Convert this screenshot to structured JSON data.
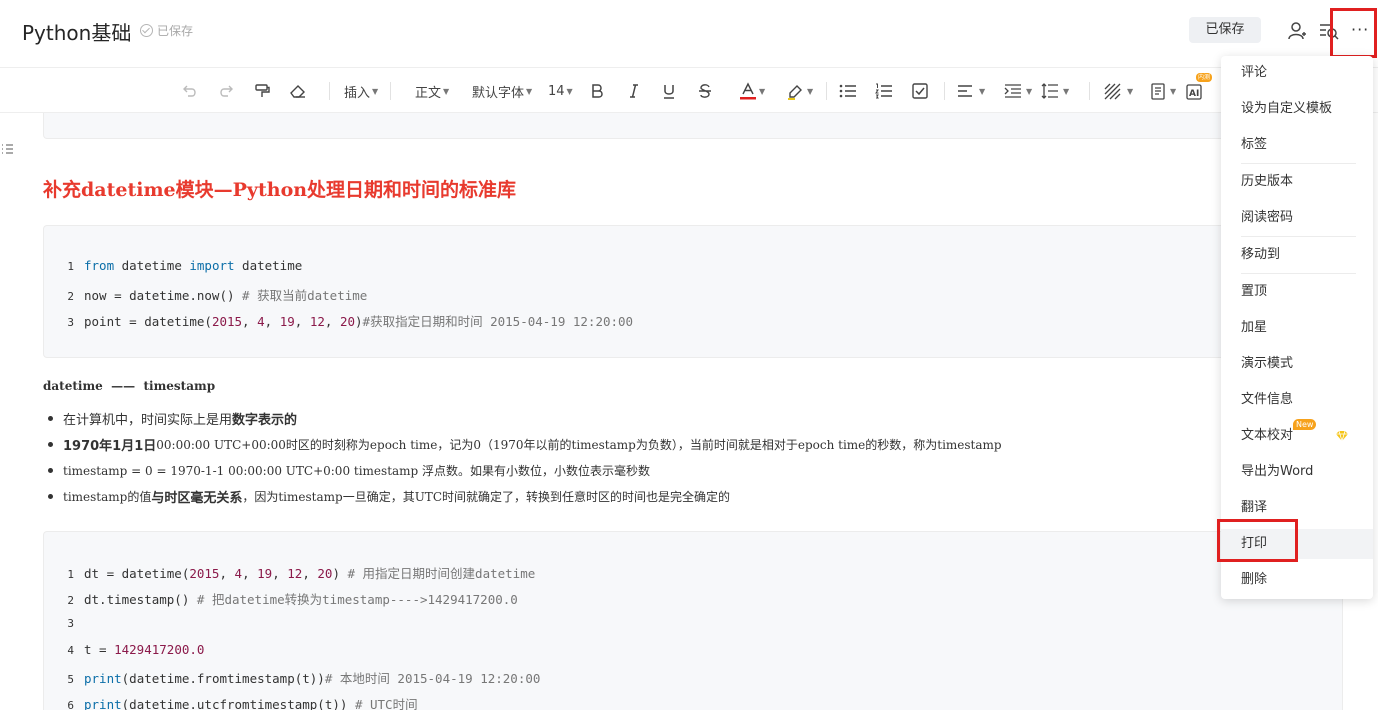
{
  "header": {
    "title": "Python基础",
    "save_status": "已保存",
    "saved_button": "已保存",
    "icons": [
      "user-share-icon",
      "search-outline-icon",
      "more-dots-icon"
    ],
    "more_label": "···"
  },
  "toolbar": {
    "insert": "插入",
    "paragraph": "正文",
    "font": "默认字体",
    "font_size": "14",
    "ai_badge": "内测",
    "text_color": "#e02020",
    "icons": [
      "undo-icon",
      "redo-icon",
      "format-painter-icon",
      "eraser-icon",
      "bold-icon",
      "italic-icon",
      "underline-icon",
      "strikethrough-icon",
      "text-color-icon",
      "highlight-icon",
      "bullet-list-icon",
      "numbered-list-icon",
      "checklist-icon",
      "align-icon",
      "indent-icon",
      "line-height-icon",
      "shading-icon",
      "template-icon",
      "ai-icon"
    ]
  },
  "content": {
    "heading": "补充datetime模块—Python处理日期和时间的标准库",
    "code1": [
      {
        "n": "1",
        "parts": [
          {
            "t": "from",
            "c": "kw"
          },
          {
            "t": " datetime ",
            "c": ""
          },
          {
            "t": "import",
            "c": "kw"
          },
          {
            "t": " datetime",
            "c": ""
          }
        ]
      },
      {
        "n": "2",
        "parts": [
          {
            "t": "now = datetime.now() ",
            "c": ""
          },
          {
            "t": "# 获取当前datetime",
            "c": "cm"
          }
        ]
      },
      {
        "n": "3",
        "parts": [
          {
            "t": "point = datetime(",
            "c": ""
          },
          {
            "t": "2015",
            "c": "num"
          },
          {
            "t": ", ",
            "c": ""
          },
          {
            "t": "4",
            "c": "num"
          },
          {
            "t": ", ",
            "c": ""
          },
          {
            "t": "19",
            "c": "num"
          },
          {
            "t": ", ",
            "c": ""
          },
          {
            "t": "12",
            "c": "num"
          },
          {
            "t": ", ",
            "c": ""
          },
          {
            "t": "20",
            "c": "num"
          },
          {
            "t": ")",
            "c": ""
          },
          {
            "t": "#获取指定日期和时间 2015-04-19 12:20:00",
            "c": "cm"
          }
        ]
      }
    ],
    "subtitle": "datetime  ——  timestamp",
    "bullets": [
      {
        "parts": [
          {
            "t": "在计算机中，时间实际上是用",
            "b": false
          },
          {
            "t": "数字表示的",
            "b": true
          }
        ]
      },
      {
        "parts": [
          {
            "t": "1970年1月1日",
            "b": true
          },
          {
            "t": " 00:00:00 UTC+00:00时区的时刻称为epoch time，记为0（1970年以前的timestamp为负数），当前时间就是相对于epoch time的秒数，称为timestamp",
            "b": false,
            "s": true
          }
        ]
      },
      {
        "parts": [
          {
            "t": "timestamp = 0 = 1970-1-1 00:00:00 UTC+0:00   timestamp 浮点数。如果有小数位，小数位表示毫秒数",
            "b": false,
            "s": true
          }
        ]
      },
      {
        "parts": [
          {
            "t": "timestamp的值",
            "b": false,
            "s": true
          },
          {
            "t": "与时区毫无关系",
            "b": true
          },
          {
            "t": "，因为timestamp一旦确定，其UTC时间就确定了，转换到任意时区的时间也是完全确定的",
            "b": false,
            "s": true
          }
        ]
      }
    ],
    "code2": [
      {
        "n": "1",
        "parts": [
          {
            "t": "dt = datetime(",
            "c": ""
          },
          {
            "t": "2015",
            "c": "num"
          },
          {
            "t": ", ",
            "c": ""
          },
          {
            "t": "4",
            "c": "num"
          },
          {
            "t": ", ",
            "c": ""
          },
          {
            "t": "19",
            "c": "num"
          },
          {
            "t": ", ",
            "c": ""
          },
          {
            "t": "12",
            "c": "num"
          },
          {
            "t": ", ",
            "c": ""
          },
          {
            "t": "20",
            "c": "num"
          },
          {
            "t": ") ",
            "c": ""
          },
          {
            "t": "# 用指定日期时间创建datetime",
            "c": "cm"
          }
        ]
      },
      {
        "n": "2",
        "parts": [
          {
            "t": "dt.timestamp() ",
            "c": ""
          },
          {
            "t": "# 把datetime转换为timestamp---->1429417200.0",
            "c": "cm"
          }
        ]
      },
      {
        "n": "3",
        "parts": []
      },
      {
        "n": "4",
        "parts": [
          {
            "t": "t = ",
            "c": ""
          },
          {
            "t": "1429417200.0",
            "c": "num"
          }
        ]
      },
      {
        "n": "5",
        "parts": [
          {
            "t": "print",
            "c": "kw"
          },
          {
            "t": "(datetime.fromtimestamp(t))",
            "c": ""
          },
          {
            "t": "# 本地时间 2015-04-19 12:20:00",
            "c": "cm"
          }
        ]
      },
      {
        "n": "6",
        "parts": [
          {
            "t": "print",
            "c": "kw"
          },
          {
            "t": "(datetime.utcfromtimestamp(t)) ",
            "c": ""
          },
          {
            "t": "# UTC时间",
            "c": "cm"
          }
        ]
      }
    ]
  },
  "menu": {
    "items": [
      "评论",
      "设为自定义模板",
      "标签",
      "历史版本",
      "阅读密码",
      "移动到",
      "置顶",
      "加星",
      "演示模式",
      "文件信息",
      "文本校对",
      "导出为Word",
      "翻译",
      "打印",
      "删除"
    ],
    "new_badge": "New",
    "highlighted": "打印"
  }
}
